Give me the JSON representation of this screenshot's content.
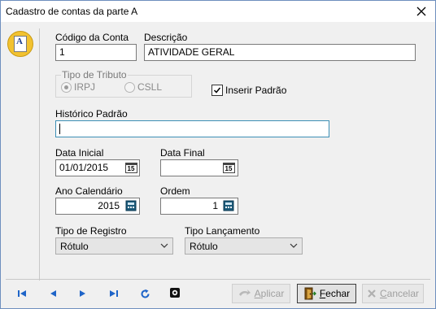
{
  "window": {
    "title": "Cadastro de contas da parte A"
  },
  "form": {
    "codigo_label": "Código da Conta",
    "codigo_value": "1",
    "descricao_label": "Descrição",
    "descricao_value": "ATIVIDADE GERAL",
    "tipo_tributo_label": "Tipo de Tributo",
    "tributo_options": [
      {
        "label": "IRPJ",
        "selected": true
      },
      {
        "label": "CSLL",
        "selected": false
      }
    ],
    "inserir_padrao_label": "Inserir Padrão",
    "inserir_padrao_checked": true,
    "historico_label": "Histórico Padrão",
    "historico_value": "",
    "data_inicial_label": "Data Inicial",
    "data_inicial_value": "01/01/2015",
    "data_final_label": "Data Final",
    "data_final_value": "",
    "calendar_icon_text": "15",
    "ano_label": "Ano Calendário",
    "ano_value": "2015",
    "ordem_label": "Ordem",
    "ordem_value": "1",
    "tipo_registro_label": "Tipo de Registro",
    "tipo_registro_value": "Rótulo",
    "tipo_lancamento_label": "Tipo Lançamento",
    "tipo_lancamento_value": "Rótulo"
  },
  "buttons": {
    "aplicar_underline": "A",
    "aplicar_rest": "plicar",
    "fechar_underline": "F",
    "fechar_rest": "echar",
    "cancelar_underline": "C",
    "cancelar_rest": "ancelar"
  },
  "colors": {
    "accent": "#1e64c8",
    "focus_border": "#3c8fb5",
    "icon_yellow": "#f2c230"
  }
}
